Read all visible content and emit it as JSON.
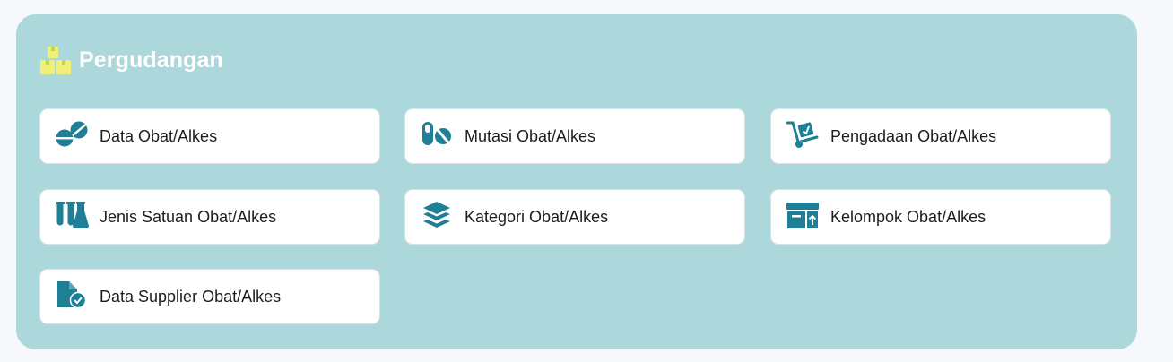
{
  "section": {
    "title": "Pergudangan",
    "icon": "boxes-icon",
    "colors": {
      "panel": "#acd7db",
      "icon_accent": "#1f7f95",
      "header_icon": "#eef07a"
    }
  },
  "menu": {
    "items": [
      {
        "label": "Data Obat/Alkes",
        "icon": "pills-icon"
      },
      {
        "label": "Mutasi Obat/Alkes",
        "icon": "capsules-icon"
      },
      {
        "label": "Pengadaan Obat/Alkes",
        "icon": "dolly-icon"
      },
      {
        "label": "Jenis Satuan Obat/Alkes",
        "icon": "flask-vial-icon"
      },
      {
        "label": "Kategori Obat/Alkes",
        "icon": "layer-group-icon"
      },
      {
        "label": "Kelompok Obat/Alkes",
        "icon": "box-archive-icon"
      },
      {
        "label": "Data Supplier Obat/Alkes",
        "icon": "file-circle-check-icon"
      }
    ]
  }
}
